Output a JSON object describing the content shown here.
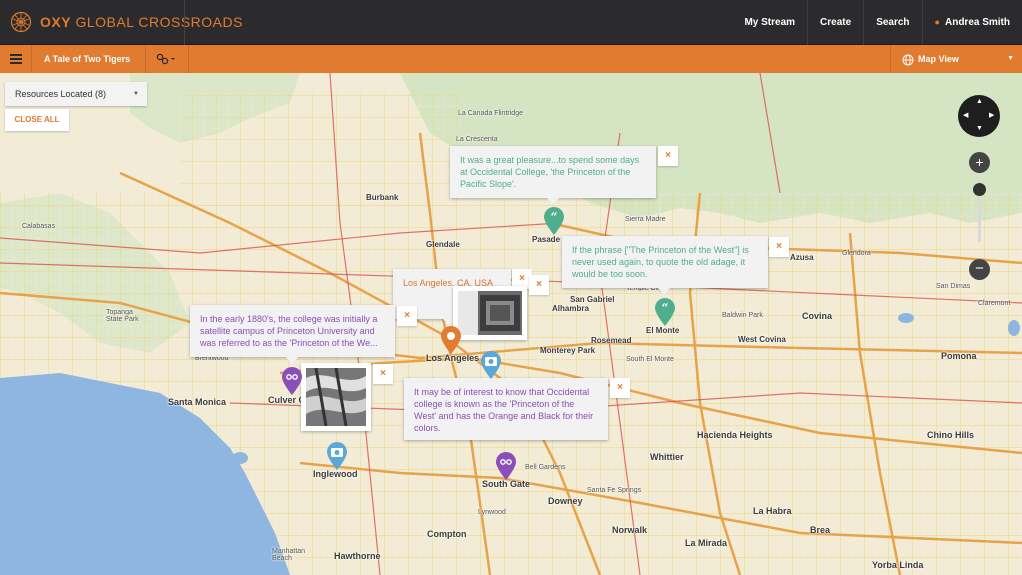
{
  "header": {
    "logo_bold": "OXY",
    "logo_rest": " GLOBAL CROSSROADS",
    "nav": [
      "My Stream",
      "Create",
      "Search"
    ],
    "user": "Andrea Smith"
  },
  "subbar": {
    "story_title": "A Tale of Two Tigers",
    "view_label": "Map View"
  },
  "resources": {
    "label": "Resources Located (8)",
    "close_all": "CLOSE ALL"
  },
  "popups": {
    "pasadena_quote": "It was a great pleasure...to spend some days at Occidental College, 'the Princeton of the Pacific Slope'.",
    "elmonte_quote": "If the phrase [\"The Princeton of the West\"] is never used again, to quote the old adage, it would be too soon.",
    "la_location": "Los Angeles, CA, USA",
    "culver_text": "In the early 1880's, the college was initially a satellite campus of Princeton University and was referred to as the 'Princeton of the We...",
    "southgate_text": "It may be of interest to know that Occidental college is known as the 'Princeton of the West' and has the Orange and Black for their colors."
  },
  "controls": {
    "close_symbol": "×",
    "zoom_in": "+",
    "zoom_out": "−"
  },
  "places": {
    "la_canada": "La Canada\nFlintridge",
    "la_crescenta": "La Crescenta",
    "burbank": "Burbank",
    "glendale": "Glendale",
    "pasadena": "Pasade",
    "sierra_madre": "Sierra Madre",
    "azusa": "Azusa",
    "glendora": "Glendora",
    "calabasas": "Calabasas",
    "topanga": "Topanga\nState Park",
    "brentwood": "Brentwood",
    "santa_monica": "Santa Monica",
    "culver_city": "Culver C",
    "inglewood": "Inglewood",
    "los_angeles": "Los Angeles",
    "alhambra": "Alhambra",
    "san_gabriel": "San Gabriel",
    "temple_city": "Temple City",
    "el_monte": "El Monte",
    "baldwin_park": "Baldwin Park",
    "covina": "Covina",
    "san_dimas": "San Dimas",
    "claremont": "Claremont",
    "rosemead": "Rosemead",
    "west_covina": "West Covina",
    "south_el_monte": "South El Monte",
    "monterey_park": "Monterey Park",
    "pomona": "Pomona",
    "hacienda_heights": "Hacienda Heights",
    "chino_hills": "Chino Hills",
    "whittier": "Whittier",
    "bell_gardens": "Bell Gardens",
    "south_gate": "South Gate",
    "downey": "Downey",
    "santa_fe_springs": "Santa Fe Springs",
    "la_habra": "La Habra",
    "brea": "Brea",
    "lynwood": "Lynwood",
    "norwalk": "Norwalk",
    "compton": "Compton",
    "la_mirada": "La Mirada",
    "hawthorne": "Hawthorne",
    "manhattan_beach": "Manhattan\nBeach",
    "yorba_linda": "Yorba Linda"
  },
  "colors": {
    "brand_orange": "#e07b2f",
    "topbar": "#2b2b2d",
    "pin_green": "#4fae8e",
    "pin_purple": "#8a4fb8",
    "pin_blue": "#5ba7d6",
    "pin_orange": "#e07b2f",
    "water": "#8fb6e0"
  }
}
